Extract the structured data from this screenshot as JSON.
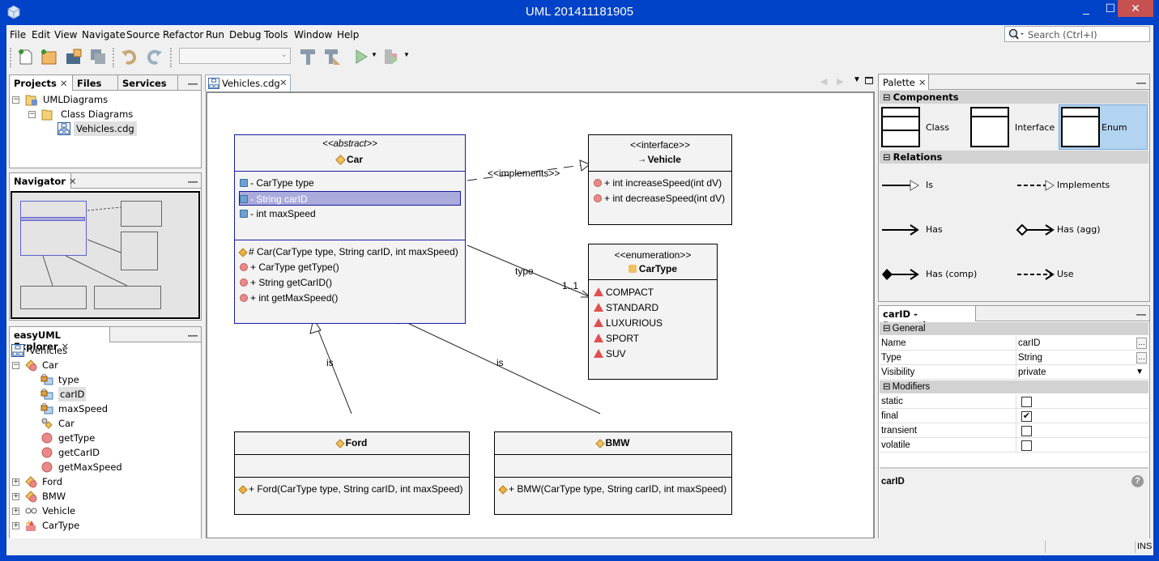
{
  "window": {
    "title": "UML 201411181905",
    "minimize": "_",
    "maximize": "☐",
    "close": "✕"
  },
  "menu": [
    "File",
    "Edit",
    "View",
    "Navigate",
    "Source",
    "Refactor",
    "Run",
    "Debug",
    "Tools",
    "Window",
    "Help"
  ],
  "search": {
    "placeholder": "Search (Ctrl+I)",
    "icon": "search-icon"
  },
  "toolbar": {
    "buttons": [
      "new-file",
      "new-project",
      "open-project",
      "save-all",
      "undo",
      "redo",
      "build",
      "clean-build",
      "run",
      "profile"
    ],
    "config_value": ""
  },
  "projects_panel": {
    "tabs": [
      "Projects",
      "Files",
      "Services"
    ],
    "close_glyph": "✕",
    "minimize_glyph": "—",
    "tree": [
      {
        "label": "UMLDiagrams",
        "level": 0,
        "expanded": true
      },
      {
        "label": "Class Diagrams",
        "level": 1,
        "expanded": true
      },
      {
        "label": "Vehicles.cdg",
        "level": 2,
        "selected": true
      }
    ]
  },
  "navigator_panel": {
    "title": "Navigator"
  },
  "explorer_panel": {
    "title": "easyUML Explorer",
    "root": "Vehicles",
    "items": [
      {
        "label": "Car",
        "level": 1,
        "icon": "class-icon",
        "expanded": true
      },
      {
        "label": "type",
        "level": 2,
        "icon": "field-icon"
      },
      {
        "label": "carID",
        "level": 2,
        "icon": "field-icon",
        "selected": true
      },
      {
        "label": "maxSpeed",
        "level": 2,
        "icon": "field-icon"
      },
      {
        "label": "Car",
        "level": 2,
        "icon": "constructor-icon"
      },
      {
        "label": "getType",
        "level": 2,
        "icon": "method-icon"
      },
      {
        "label": "getCarID",
        "level": 2,
        "icon": "method-icon"
      },
      {
        "label": "getMaxSpeed",
        "level": 2,
        "icon": "method-icon"
      },
      {
        "label": "Ford",
        "level": 1,
        "icon": "class-icon",
        "expanded": false
      },
      {
        "label": "BMW",
        "level": 1,
        "icon": "class-icon",
        "expanded": false
      },
      {
        "label": "Vehicle",
        "level": 1,
        "icon": "interface-icon",
        "expanded": false
      },
      {
        "label": "CarType",
        "level": 1,
        "icon": "enum-icon",
        "expanded": false
      }
    ]
  },
  "editor": {
    "tab": "Vehicles.cdg",
    "classes": {
      "car": {
        "stereotype": "<<abstract>>",
        "name": "Car",
        "fields": [
          "- CarType type",
          "- String carID",
          "- int maxSpeed"
        ],
        "selected_field": 1,
        "methods": [
          "# Car(CarType type, String carID, int maxSpeed)",
          "+ CarType getType()",
          "+ String getCarID()",
          "+ int getMaxSpeed()"
        ]
      },
      "vehicle": {
        "stereotype": "<<interface>>",
        "name": "Vehicle",
        "methods": [
          "+ int increaseSpeed(int dV)",
          "+ int decreaseSpeed(int dV)"
        ]
      },
      "cartype": {
        "stereotype": "<<enumeration>>",
        "name": "CarType",
        "literals": [
          "COMPACT",
          "STANDARD",
          "LUXURIOUS",
          "SPORT",
          "SUV"
        ]
      },
      "ford": {
        "name": "Ford",
        "methods": [
          "+ Ford(CarType type, String carID, int maxSpeed)"
        ]
      },
      "bmw": {
        "name": "BMW",
        "methods": [
          "+ BMW(CarType type, String carID, int maxSpeed)"
        ]
      }
    },
    "relations": {
      "implements_label": "<<implements>>",
      "type_label": "type",
      "multiplicity": "1..1",
      "is_label_1": "is",
      "is_label_2": "is"
    }
  },
  "palette": {
    "title": "Palette",
    "components_header": "Components",
    "relations_header": "Relations",
    "components": [
      "Class",
      "Interface",
      "Enum"
    ],
    "selected_component": "Enum",
    "relations": [
      "Is",
      "Implements",
      "Has",
      "Has (agg)",
      "Has (comp)",
      "Use"
    ]
  },
  "properties": {
    "title": "carID - Properties",
    "general_header": "General",
    "modifiers_header": "Modifiers",
    "general": [
      {
        "key": "Name",
        "value": "carID"
      },
      {
        "key": "Type",
        "value": "String"
      },
      {
        "key": "Visibility",
        "value": "private"
      }
    ],
    "modifiers": [
      {
        "key": "static",
        "checked": false
      },
      {
        "key": "final",
        "checked": true
      },
      {
        "key": "transient",
        "checked": false
      },
      {
        "key": "volatile",
        "checked": false
      }
    ],
    "description_title": "carID"
  },
  "status": {
    "mode": "INS"
  },
  "colors": {
    "titlebar": "#0042c8",
    "close": "#c75050",
    "selection": "#aaaadc",
    "palette_selected": "#b3d4f0"
  }
}
